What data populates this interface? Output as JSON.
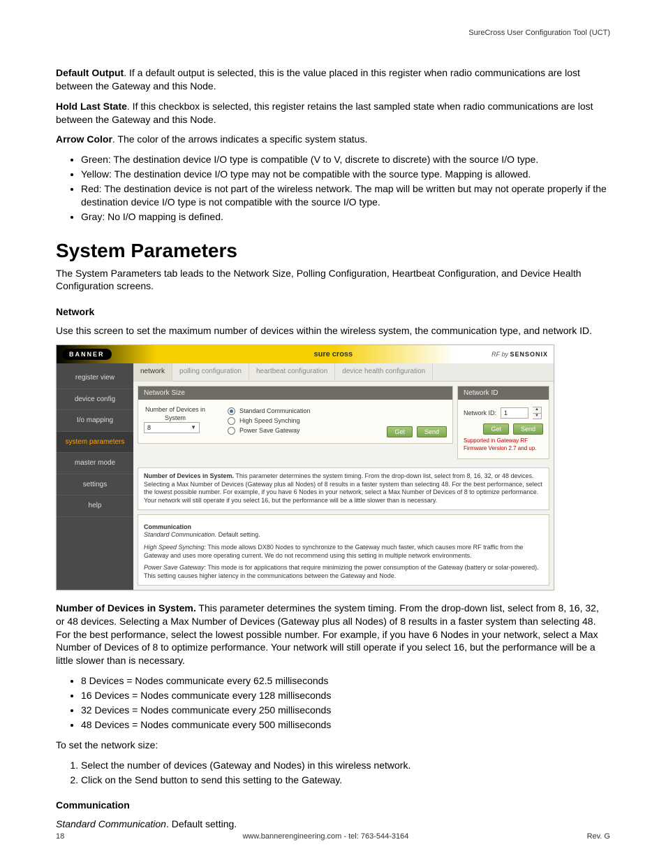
{
  "header_right": "SureCross User Configuration Tool (UCT)",
  "p1": {
    "b": "Default Output",
    "t": ". If a default output is selected, this is the value placed in this register when radio communications are lost between the Gateway and this Node."
  },
  "p2": {
    "b": "Hold Last State",
    "t": ". If this checkbox is selected, this register retains the last sampled state when radio communications are lost between the Gateway and this Node."
  },
  "p3": {
    "b": "Arrow Color",
    "t": ". The color of the arrows indicates a specific system status."
  },
  "arrow_list": [
    "Green: The destination device I/O type is compatible (V to V, discrete to discrete) with the source I/O type.",
    "Yellow: The destination device I/O type may not be compatible with the source type. Mapping is allowed.",
    "Red: The destination device is not part of the wireless network. The map will be written but may not operate properly if the destination device I/O type is not compatible with the source I/O type.",
    "Gray: No I/O mapping is defined."
  ],
  "h1": "System Parameters",
  "sp_intro": "The System Parameters tab leads to the Network Size, Polling Configuration, Heartbeat Configuration, and Device Health Configuration screens.",
  "network_head": "Network",
  "network_intro": "Use this screen to set the maximum number of devices within the wireless system, the communication type, and network ID.",
  "shot": {
    "banner": "BANNER",
    "sure": "sure cross",
    "rfby_pre": "RF by ",
    "rfby_b": "SENSONIX",
    "side": [
      {
        "label": "register view",
        "sel": false
      },
      {
        "label": "device config",
        "sel": false
      },
      {
        "label": "I/o mapping",
        "sel": false
      },
      {
        "label": "system parameters",
        "sel": true
      },
      {
        "label": "master mode",
        "sel": false
      },
      {
        "label": "settings",
        "sel": false
      },
      {
        "label": "help",
        "sel": false
      }
    ],
    "tabs": [
      {
        "label": "network",
        "sel": true
      },
      {
        "label": "polling configuration",
        "sel": false
      },
      {
        "label": "heartbeat configuration",
        "sel": false
      },
      {
        "label": "device health configuration",
        "sel": false
      }
    ],
    "leftPanel": {
      "title": "Network Size",
      "numdev_label": "Number of Devices in System",
      "numdev_value": "8",
      "radios": [
        {
          "label": "Standard Communication",
          "sel": true
        },
        {
          "label": "High Speed Synching",
          "sel": false
        },
        {
          "label": "Power Save Gateway",
          "sel": false
        }
      ],
      "get": "Get",
      "send": "Send"
    },
    "rightPanel": {
      "title": "Network ID",
      "label": "Network ID:",
      "value": "1",
      "get": "Get",
      "send": "Send",
      "note": "Supported in Gateway RF Firmware Version 2.7 and up."
    },
    "help1": {
      "b": "Number of Devices in System.",
      "t": " This parameter determines the system timing. From the drop-down list, select from 8, 16, 32, or 48 devices. Selecting a Max Number of Devices (Gateway plus all Nodes) of 8 results in a faster system than selecting 48. For the best performance, select the lowest possible number. For example, if you have 6 Nodes in your network, select a Max Number of Devices of 8 to optimize performance. Your network will still operate if you select 16, but the performance will be a little slower than is necessary."
    },
    "help2": {
      "head": "Communication",
      "std_i": "Standard Communication.",
      "std_t": " Default setting.",
      "hss_i": "High Speed Synching:",
      "hss_t": " This mode allows DX80 Nodes to synchronize to the Gateway much faster, which causes more RF traffic from the Gateway and uses more operating current. We do not recommend using this setting in multiple network environments.",
      "psg_i": "Power Save Gateway:",
      "psg_t": " This mode is for applications that require minimizing the power consumption of the Gateway (battery or solar-powered). This setting causes higher latency in the communications between the Gateway and Node."
    }
  },
  "nd": {
    "b": "Number of Devices in System.",
    "t": " This parameter determines the system timing. From the drop-down list, select from 8, 16, 32, or 48 devices. Selecting a Max Number of Devices (Gateway plus all Nodes) of 8 results in a faster system than selecting 48. For the best performance, select the lowest possible number. For example, if you have 6 Nodes in your network, select a Max Number of Devices of 8 to optimize performance. Your network will still operate if you select 16, but the performance will be a little slower than is necessary."
  },
  "dev_list": [
    "8 Devices = Nodes communicate every 62.5 milliseconds",
    "16 Devices = Nodes communicate every 128 milliseconds",
    "32 Devices = Nodes communicate every 250 milliseconds",
    "48 Devices = Nodes communicate every 500 milliseconds"
  ],
  "set_intro": "To set the network size:",
  "set_steps": [
    "Select the number of devices (Gateway and Nodes) in this wireless network.",
    "Click on the Send button to send this setting to the Gateway."
  ],
  "comm_head": "Communication",
  "comm_std": {
    "i": "Standard Communication",
    "t": ". Default setting."
  },
  "footer": {
    "page": "18",
    "center": "www.bannerengineering.com - tel: 763-544-3164",
    "rev": "Rev. G"
  }
}
